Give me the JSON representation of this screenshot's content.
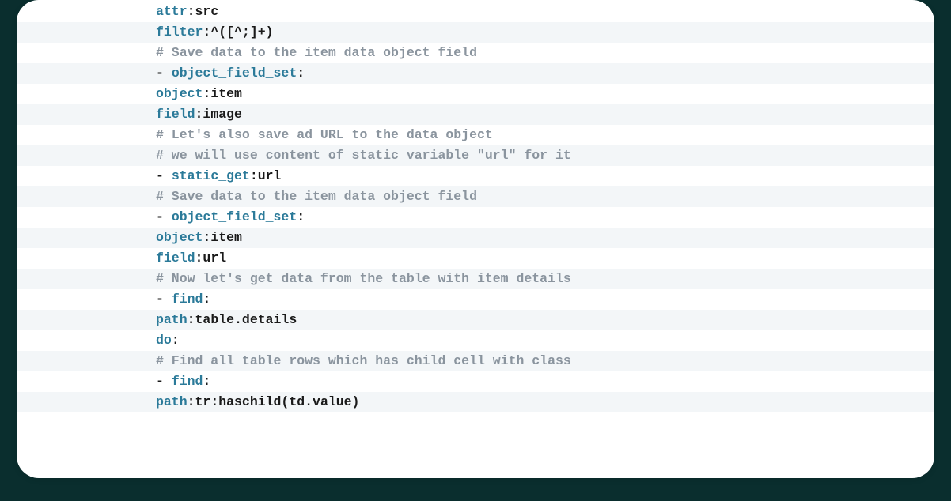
{
  "lines": [
    {
      "indent": 30,
      "type": "kv",
      "key": "attr",
      "val": "src"
    },
    {
      "indent": 30,
      "type": "kv",
      "key": "filter",
      "val": "^([^;]+)"
    },
    {
      "indent": 22,
      "type": "comment",
      "text": "# Save data to the item data object field"
    },
    {
      "indent": 22,
      "type": "dashkey",
      "key": "object_field_set"
    },
    {
      "indent": 26,
      "type": "kv",
      "key": "object",
      "val": "item"
    },
    {
      "indent": 26,
      "type": "kv",
      "key": "field",
      "val": "image"
    },
    {
      "indent": 20,
      "type": "comment",
      "text": "# Let's also save ad URL to the data object"
    },
    {
      "indent": 20,
      "type": "comment",
      "text": "# we will use content of static variable \"url\" for it"
    },
    {
      "indent": 20,
      "type": "dashkv",
      "key": "static_get",
      "val": "url"
    },
    {
      "indent": 20,
      "type": "comment",
      "text": "# Save data to the item data object field"
    },
    {
      "indent": 20,
      "type": "dashkey",
      "key": "object_field_set"
    },
    {
      "indent": 24,
      "type": "kv",
      "key": "object",
      "val": "item"
    },
    {
      "indent": 24,
      "type": "kv",
      "key": "field",
      "val": "url"
    },
    {
      "indent": 20,
      "type": "comment",
      "text": "# Now let's get data from the table with item details"
    },
    {
      "indent": 20,
      "type": "dashkey",
      "key": "find"
    },
    {
      "indent": 24,
      "type": "kv",
      "key": "path",
      "val": "table.details"
    },
    {
      "indent": 24,
      "type": "keyonly",
      "key": "do"
    },
    {
      "indent": 24,
      "type": "comment",
      "text": "# Find all table rows which has child cell with class"
    },
    {
      "indent": 24,
      "type": "dashkey",
      "key": "find"
    },
    {
      "indent": 28,
      "type": "kv",
      "key": "path",
      "val": "tr:haschild(td.value)"
    }
  ]
}
